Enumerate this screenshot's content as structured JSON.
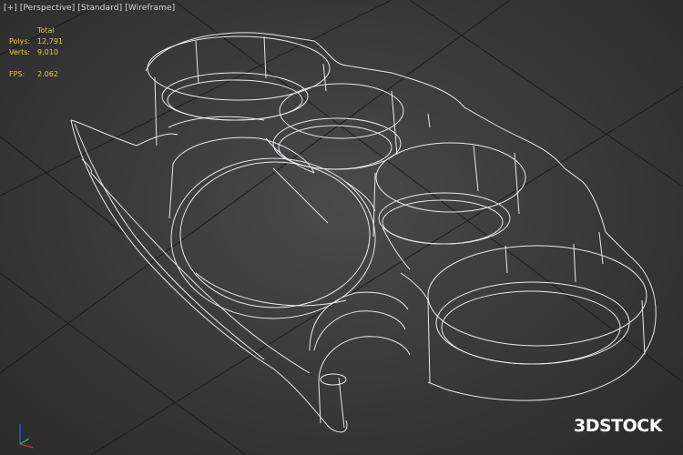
{
  "viewport": {
    "menu": {
      "plus": "[+]",
      "view": "[Perspective]",
      "shading": "[Standard]",
      "mode": "[Wireframe]"
    },
    "stats": {
      "header": "Total",
      "polys_label": "Polys:",
      "polys_value": "12,791",
      "verts_label": "Verts:",
      "verts_value": "9,010",
      "fps_label": "FPS:",
      "fps_value": "2.062"
    },
    "watermark": "3DSTOCK",
    "colors": {
      "stats_text": "#e9c84a",
      "wire": "#e8e8ee",
      "grid": "#1a1a1a",
      "axis_x": "#d03030",
      "axis_y": "#30c030",
      "axis_z": "#3060ff"
    },
    "object": "brass-knuckles-wireframe"
  }
}
